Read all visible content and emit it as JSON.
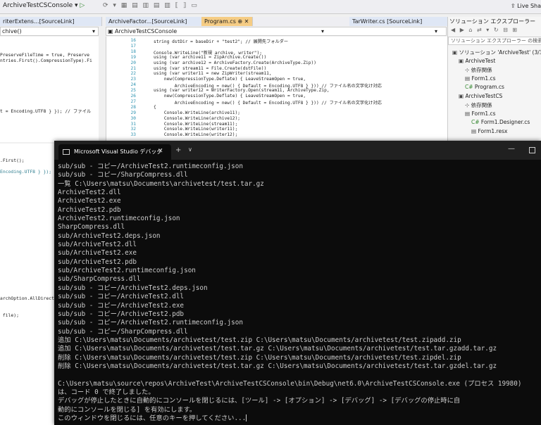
{
  "toolbar": {
    "run_target": "ArchiveTestCSConsole",
    "live_share": "Live Sha"
  },
  "tabs": {
    "left": "riterExtens...[SourceLink]",
    "middle_left": "ArchiveFactor...[SourceLink]",
    "program": "Program.cs",
    "tarwriter": "TarWriter.cs [SourceLink]"
  },
  "navbar": {
    "left_value": "chive()",
    "center_value": "ArchiveTestCSConsole"
  },
  "left_editor": {
    "lines": [
      {
        "text": "PreserveFileTime = true, Preserve"
      },
      {
        "text": "ntries.First().CompressionType).Fi"
      },
      {
        "text": "t = Encoding.UTF8 } }); // ファイル"
      }
    ]
  },
  "left_lower": {
    "lines": [
      {
        "text": ".First();"
      },
      {
        "text": "Encoding.UTF8 } });"
      },
      {
        "text": "archOption.AllDirect"
      },
      {
        "text": " file);"
      }
    ]
  },
  "center_editor": {
    "lines": [
      {
        "num": "16",
        "text": "string dstDir = baseDir + \"test2\"; // 展開先フォルダー"
      },
      {
        "num": "17",
        "text": ""
      },
      {
        "num": "18",
        "text": "Console.WriteLine(\"新規 archive, writer\");"
      },
      {
        "num": "19",
        "text": "using (var archive11 = ZipArchive.Create())"
      },
      {
        "num": "20",
        "text": "using (var archive12 = ArchiveFactory.Create(ArchiveType.Zip))"
      },
      {
        "num": "21",
        "text": "using (var stream11 = File.Create(dstFile))"
      },
      {
        "num": "22",
        "text": "using (var writer11 = new ZipWriter(stream11,"
      },
      {
        "num": "23",
        "text": "    new(CompressionType.Deflate) { LeaveStreamOpen = true,"
      },
      {
        "num": "24",
        "text": "        ArchiveEncoding = new() { Default = Encoding.UTF8 } })) // ファイル名の文字化け対応"
      },
      {
        "num": "25",
        "text": "using (var writer12 = WriterFactory.Open(stream11, ArchiveType.Zip,"
      },
      {
        "num": "26",
        "text": "    new(CompressionType.Deflate) { LeaveStreamOpen = true,"
      },
      {
        "num": "27",
        "text": "        ArchiveEncoding = new() { Default = Encoding.UTF8 } })) // ファイル名の文字化け対応"
      },
      {
        "num": "28",
        "text": "{"
      },
      {
        "num": "29",
        "text": "    Console.WriteLine(archive11);"
      },
      {
        "num": "30",
        "text": "    Console.WriteLine(archive12);"
      },
      {
        "num": "31",
        "text": "    Console.WriteLine(stream11);"
      },
      {
        "num": "32",
        "text": "    Console.WriteLine(writer11);"
      },
      {
        "num": "33",
        "text": "    Console.WriteLine(writer12);"
      }
    ]
  },
  "solution_explorer": {
    "title": "ソリューション エクスプローラー",
    "search_placeholder": "ソリューション エクスプローラー の検索 (Ctrl+",
    "items": [
      {
        "label": "ソリューション 'ArchiveTest' (3/3 の",
        "indent": 0
      },
      {
        "label": "ArchiveTest",
        "indent": 1
      },
      {
        "label": "依存関係",
        "indent": 2
      },
      {
        "label": "Form1.cs",
        "indent": 2
      },
      {
        "label": "Program.cs",
        "indent": 2
      },
      {
        "label": "ArchiveTestCS",
        "indent": 1
      },
      {
        "label": "依存関係",
        "indent": 2
      },
      {
        "label": "Form1.cs",
        "indent": 2
      },
      {
        "label": "Form1.Designer.cs",
        "indent": 3
      },
      {
        "label": "Form1.resx",
        "indent": 3
      }
    ]
  },
  "console": {
    "tab_title": "Microsoft Visual Studio デバッグ",
    "lines": [
      "sub/sub - コピー/ArchiveTest2.runtimeconfig.json",
      "sub/sub - コピー/SharpCompress.dll",
      "一覧 C:\\Users\\matsu\\Documents\\archivetest/test.tar.gz",
      "ArchiveTest2.dll",
      "ArchiveTest2.exe",
      "ArchiveTest2.pdb",
      "ArchiveTest2.runtimeconfig.json",
      "SharpCompress.dll",
      "sub/ArchiveTest2.deps.json",
      "sub/ArchiveTest2.dll",
      "sub/ArchiveTest2.exe",
      "sub/ArchiveTest2.pdb",
      "sub/ArchiveTest2.runtimeconfig.json",
      "sub/SharpCompress.dll",
      "sub/sub - コピー/ArchiveTest2.deps.json",
      "sub/sub - コピー/ArchiveTest2.dll",
      "sub/sub - コピー/ArchiveTest2.exe",
      "sub/sub - コピー/ArchiveTest2.pdb",
      "sub/sub - コピー/ArchiveTest2.runtimeconfig.json",
      "sub/sub - コピー/SharpCompress.dll",
      "追加 C:\\Users\\matsu\\Documents/archivetest/test.zip C:\\Users\\matsu\\Documents/archivetest/test.zipadd.zip",
      "追加 C:\\Users\\matsu\\Documents/archivetest/test.tar.gz C:\\Users\\matsu\\Documents/archivetest/test.tar.gzadd.tar.gz",
      "削除 C:\\Users\\matsu\\Documents/archivetest/test.zip C:\\Users\\matsu\\Documents/archivetest/test.zipdel.zip",
      "削除 C:\\Users\\matsu\\Documents/archivetest/test.tar.gz C:\\Users\\matsu\\Documents/archivetest/test.tar.gzdel.tar.gz",
      "",
      "C:\\Users\\matsu\\source\\repos\\ArchiveTest\\ArchiveTestCSConsole\\bin\\Debug\\net6.0\\ArchiveTestCSConsole.exe (プロセス 19980)",
      "は、コード 0 で終了しました。",
      "デバッグが停止したときに自動的にコンソールを閉じるには、[ツール] -> [オプション] -> [デバッグ] -> [デバッグの停止時に自",
      "動的にコンソールを閉じる] を有効にします。",
      "このウィンドウを閉じるには、任意のキーを押してください..."
    ]
  }
}
